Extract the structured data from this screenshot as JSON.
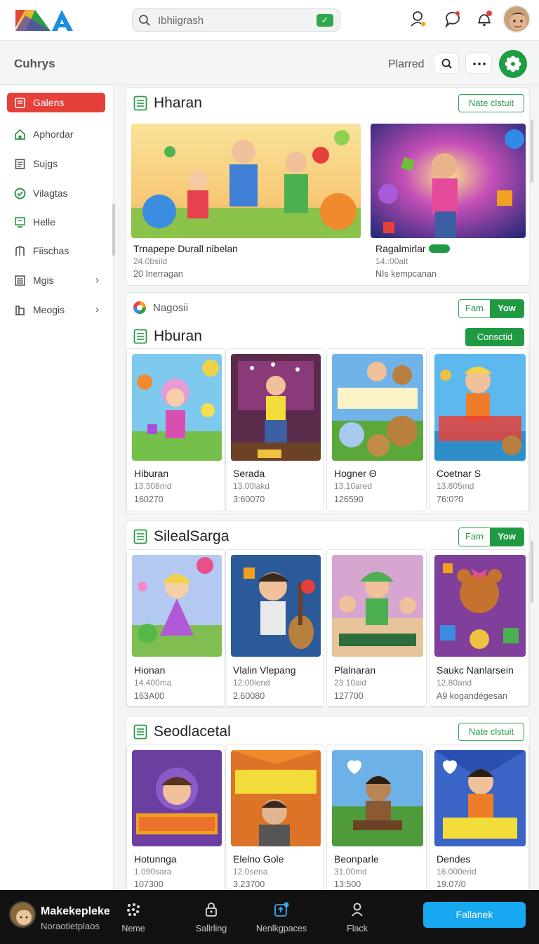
{
  "colors": {
    "accent_green": "#1f9a43",
    "active_red": "#e5413a",
    "cta_blue": "#16a8f0"
  },
  "topbar": {
    "logo_icon": "app-logo",
    "search": {
      "value": "Ibhiigrash",
      "badge": "✓"
    },
    "icons": [
      "user-search-icon",
      "chat-icon",
      "bell-notification-icon",
      "user-avatar"
    ]
  },
  "subheader": {
    "title": "Cuhrys",
    "link": "Plarred",
    "search_icon": "search-icon",
    "more_icon": "more-icon",
    "fab_icon": "settings-gear-icon"
  },
  "sidebar": {
    "items": [
      {
        "label": "Galens",
        "icon": "grid-icon",
        "active": true
      },
      {
        "label": "Aphordar",
        "icon": "home-icon"
      },
      {
        "label": "Sujgs",
        "icon": "document-icon"
      },
      {
        "label": "Vilagtas",
        "icon": "check-circle-icon"
      },
      {
        "label": "Helle",
        "icon": "monitor-icon"
      },
      {
        "label": "Fiischas",
        "icon": "bookmark-icon"
      },
      {
        "label": "Mgis",
        "icon": "list-icon",
        "chevron": "›"
      },
      {
        "label": "Meogis",
        "icon": "library-icon",
        "chevron": "›"
      }
    ]
  },
  "main": {
    "section1": {
      "title": "Hharan",
      "button": "Nate clstuit",
      "cards": [
        {
          "title": "Trnapepe Durall nibelan",
          "meta": "24.0bsild",
          "meta2": "20 Inerragan"
        },
        {
          "title": "Ragalmirlar",
          "meta": "14.:00alt",
          "meta2": "NIs kempcanan"
        }
      ]
    },
    "section2": {
      "brand": "Nagosii",
      "seg_a": "Fam",
      "seg_b": "Yow",
      "title": "Hburan",
      "button": "Consctid",
      "cards": [
        {
          "title": "Hiburan",
          "meta": "13.308md",
          "meta2": "160270"
        },
        {
          "title": "Serada",
          "meta": "13.00lakd",
          "meta2": "3:60070"
        },
        {
          "title": "Hogner Θ",
          "meta": "13.10ared",
          "meta2": "126590"
        },
        {
          "title": "Coetnar S",
          "meta": "13.805md",
          "meta2": "76:0?0"
        }
      ]
    },
    "section3": {
      "title": "SilealSarga",
      "seg_a": "Fam",
      "seg_b": "Yow",
      "cards": [
        {
          "title": "Hionan",
          "meta": "14.400ma",
          "meta2": "163A00"
        },
        {
          "title": "Vlalin Vlepang",
          "meta": "12:00lend",
          "meta2": "2.60080"
        },
        {
          "title": "Plalnaran",
          "meta": "23 10aid",
          "meta2": "127700"
        },
        {
          "title": "Saukc Nanlarsein",
          "meta": "12.80and",
          "meta2": "A9 kogandégesan"
        }
      ]
    },
    "section4": {
      "title": "Seodlacetal",
      "button": "Nate clstuit",
      "cards": [
        {
          "title": "Hotunnga",
          "meta": "1.090sara",
          "meta2": "107300"
        },
        {
          "title": "Elelno Gole",
          "meta": "12.0sena",
          "meta2": "3.23700"
        },
        {
          "title": "Beonparle",
          "meta": "31.00md",
          "meta2": "13:500"
        },
        {
          "title": "Dendes",
          "meta": "16.000erid",
          "meta2": "19.07/0"
        }
      ]
    }
  },
  "bottombar": {
    "user_name": "Makekepleke",
    "user_sub": "Noraotietplaos",
    "tabs": [
      {
        "label": "Neme",
        "icon": "dots-grid-icon"
      },
      {
        "label": "Sallrling",
        "icon": "lock-icon"
      },
      {
        "label": "Nenlkgpaces",
        "icon": "upload-icon"
      },
      {
        "label": "Flack",
        "icon": "person-icon"
      }
    ],
    "cta": "Fallanek"
  }
}
